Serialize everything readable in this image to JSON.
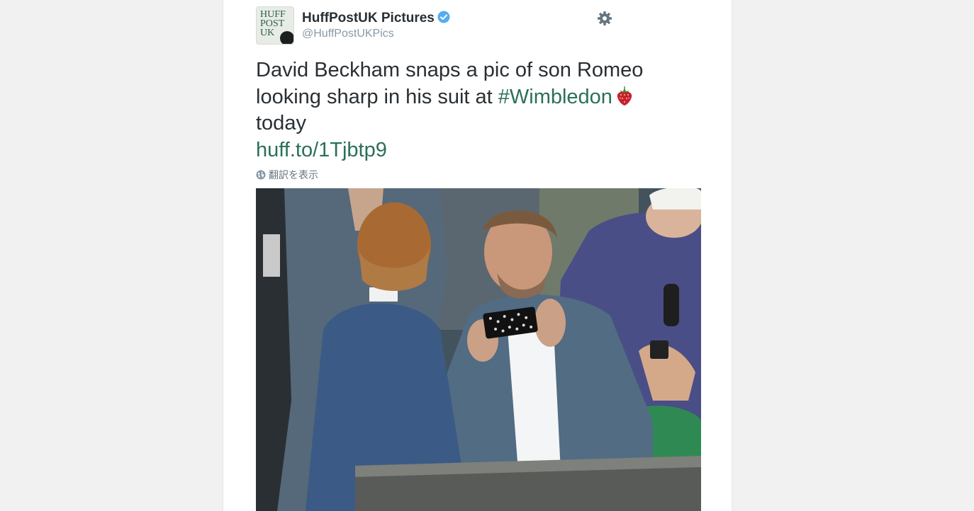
{
  "tweet": {
    "display_name": "HuffPostUK Pictures",
    "screen_name": "@HuffPostUKPics",
    "avatar_text": "HUFF\nPOST\nUK",
    "verified": true,
    "text_line1": "David Beckham snaps a pic of son  Romeo",
    "text_line2_prefix": "looking sharp in his suit at ",
    "hashtag": "#Wimbledon",
    "text_line3": "today",
    "link": "huff.to/1Tjbtp9",
    "translate_label": "翻訳を表示"
  },
  "icons": {
    "verified": "verified-badge-icon",
    "settings": "gear-icon",
    "emoji": "strawberry-emoji",
    "translate": "globe-icon"
  },
  "colors": {
    "page_background": "#f1f1f1",
    "card_background": "#ffffff",
    "text": "#292f33",
    "muted": "#8899a6",
    "link": "#2b7057",
    "verified": "#55acee"
  }
}
